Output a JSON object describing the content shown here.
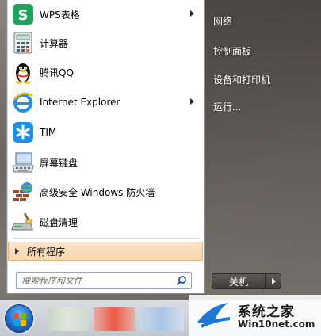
{
  "programs": [
    {
      "label": "WPS表格",
      "icon": "wps-spreadsheet-icon",
      "has_submenu": true
    },
    {
      "label": "计算器",
      "icon": "calculator-icon",
      "has_submenu": false
    },
    {
      "label": "腾讯QQ",
      "icon": "qq-penguin-icon",
      "has_submenu": false
    },
    {
      "label": "Internet Explorer",
      "icon": "internet-explorer-icon",
      "has_submenu": true
    },
    {
      "label": "TIM",
      "icon": "tim-icon",
      "has_submenu": false
    },
    {
      "label": "屏幕键盘",
      "icon": "on-screen-keyboard-icon",
      "has_submenu": false
    },
    {
      "label": "高级安全 Windows 防火墙",
      "icon": "firewall-icon",
      "has_submenu": false
    },
    {
      "label": "磁盘清理",
      "icon": "disk-cleanup-icon",
      "has_submenu": false
    }
  ],
  "all_programs_label": "所有程序",
  "search": {
    "placeholder": "搜索程序和文件",
    "value": ""
  },
  "right_links": [
    "网络",
    "控制面板",
    "设备和打印机",
    "运行..."
  ],
  "shutdown_label": "关机",
  "watermark": {
    "title": "系统之家",
    "url": "Win10net.com"
  },
  "colors": {
    "all_programs_bg": "#f7d7ad",
    "wps_green": "#1fa45b",
    "tim_blue": "#1e8fe8"
  }
}
